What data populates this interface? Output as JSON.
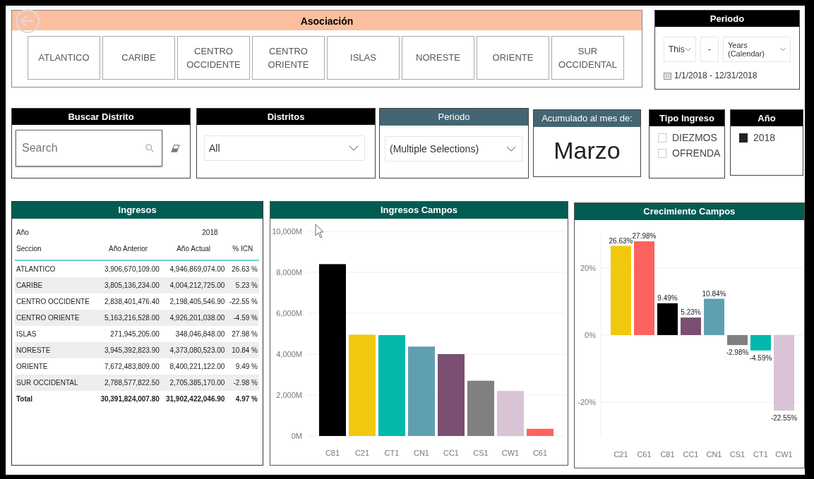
{
  "association": {
    "title": "Asociación",
    "items": [
      {
        "label": "ATLANTICO",
        "selected": false
      },
      {
        "label": "CARIBE",
        "selected": false
      },
      {
        "label": "CENTRO OCCIDENTE",
        "selected": false
      },
      {
        "label": "CENTRO ORIENTE",
        "selected": false
      },
      {
        "label": "ISLAS",
        "selected": false
      },
      {
        "label": "NORESTE",
        "selected": false
      },
      {
        "label": "ORIENTE",
        "selected": false
      },
      {
        "label": "SUR OCCIDENTAL",
        "selected": false
      }
    ]
  },
  "period_filter": {
    "title": "Periodo",
    "relative": "This",
    "count": "-",
    "unit": "Years (Calendar)",
    "range": "1/1/2018 - 12/31/2018"
  },
  "district_search": {
    "title": "Buscar Distrito",
    "placeholder": "Search"
  },
  "districts": {
    "title": "Distritos",
    "value": "All"
  },
  "period": {
    "title": "Periodo",
    "value": "(Multiple Selections)"
  },
  "accumulated": {
    "title": "Acumulado al mes de:",
    "value": "Marzo"
  },
  "income_type": {
    "title": "Tipo Ingreso",
    "options": [
      {
        "label": "DIEZMOS",
        "checked": false
      },
      {
        "label": "OFRENDA",
        "checked": false
      }
    ]
  },
  "year": {
    "title": "Año",
    "options": [
      {
        "label": "2018",
        "checked": true
      }
    ]
  },
  "income_table": {
    "title": "Ingresos",
    "year_label": "Año",
    "year": "2018",
    "columns": [
      "Seccion",
      "Año Anterior",
      "Año Actual",
      "% ICN"
    ],
    "rows": [
      [
        "ATLANTICO",
        "3,906,670,109.00",
        "4,946,869,074.00",
        "26.63 %"
      ],
      [
        "CARIBE",
        "3,805,136,234.00",
        "4,004,212,725.00",
        "5.23 %"
      ],
      [
        "CENTRO OCCIDENTE",
        "2,838,401,476.40",
        "2,198,405,546.90",
        "-22.55 %"
      ],
      [
        "CENTRO ORIENTE",
        "5,163,216,528.00",
        "4,926,201,038.00",
        "-4.59 %"
      ],
      [
        "ISLAS",
        "271,945,205.00",
        "348,046,848.00",
        "27.98 %"
      ],
      [
        "NORESTE",
        "3,945,392,823.90",
        "4,373,080,523.00",
        "10.84 %"
      ],
      [
        "ORIENTE",
        "7,672,483,809.00",
        "8,400,221,122.00",
        "9.49 %"
      ],
      [
        "SUR OCCIDENTAL",
        "2,788,577,822.50",
        "2,705,385,170.00",
        "-2.98 %"
      ]
    ],
    "total": [
      "Total",
      "30,391,824,007.80",
      "31,902,422,046.90",
      "4.97 %"
    ]
  },
  "income_chart": {
    "title": "Ingresos Campos",
    "bars": [
      {
        "color": "#000000"
      },
      {
        "color": "#f2c80f"
      },
      {
        "color": "#01b8aa"
      },
      {
        "color": "#5f9fb0"
      },
      {
        "color": "#7a4f71"
      },
      {
        "color": "#808080"
      },
      {
        "color": "#d9c3d6"
      },
      {
        "color": "#fd625e"
      }
    ],
    "chart_data": {
      "type": "bar",
      "grid": true,
      "categories": [
        "C81",
        "C21",
        "CT1",
        "CN1",
        "CC1",
        "CS1",
        "CW1",
        "C61"
      ],
      "series": [
        {
          "values": [
            8400,
            4950,
            4930,
            4370,
            4000,
            2700,
            2200,
            350
          ]
        }
      ],
      "ylim": [
        0,
        10000
      ],
      "yticks": [
        {
          "value": 0,
          "label": "0M"
        },
        {
          "value": 2000,
          "label": "2,000M"
        },
        {
          "value": 4000,
          "label": "4,000M"
        },
        {
          "value": 6000,
          "label": "6,000M"
        },
        {
          "value": 8000,
          "label": "8,000M"
        },
        {
          "value": 10000,
          "label": "10,000M"
        }
      ]
    }
  },
  "growth_chart": {
    "title": "Crecimiento Campos",
    "bars": [
      {
        "color": "#f2c80f"
      },
      {
        "color": "#fd625e"
      },
      {
        "color": "#000000"
      },
      {
        "color": "#7a4f71"
      },
      {
        "color": "#5f9fb0"
      },
      {
        "color": "#808080"
      },
      {
        "color": "#01b8aa"
      },
      {
        "color": "#d9c3d6"
      }
    ],
    "chart_data": {
      "type": "bar",
      "grid": true,
      "categories": [
        "C21",
        "C61",
        "C81",
        "CC1",
        "CN1",
        "CS1",
        "CT1",
        "CW1"
      ],
      "series": [
        {
          "values": [
            26.63,
            27.98,
            9.49,
            5.23,
            10.84,
            -2.98,
            -4.59,
            -22.55
          ]
        }
      ],
      "ylim": [
        -30,
        30
      ],
      "yticks": [
        {
          "value": -20,
          "label": "-20%"
        },
        {
          "value": 0,
          "label": "0%"
        },
        {
          "value": 20,
          "label": "20%"
        }
      ],
      "value_labels": [
        "26.63%",
        "27.98%",
        "9.49%",
        "5.23%",
        "10.84%",
        "-2.98%",
        "-4.59%",
        "-22.55%"
      ]
    }
  }
}
